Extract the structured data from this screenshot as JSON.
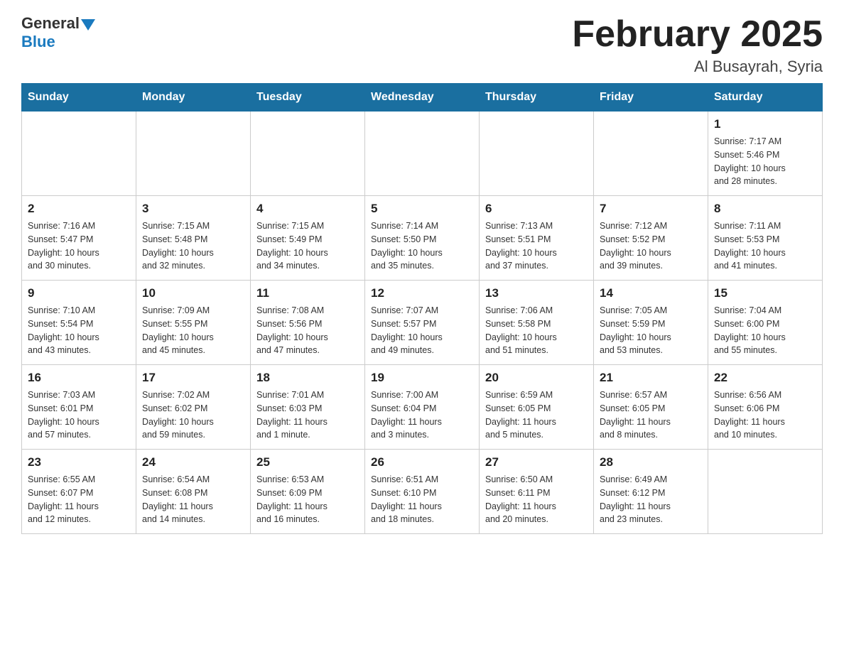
{
  "header": {
    "logo_general": "General",
    "logo_blue": "Blue",
    "month_title": "February 2025",
    "location": "Al Busayrah, Syria"
  },
  "days_of_week": [
    "Sunday",
    "Monday",
    "Tuesday",
    "Wednesday",
    "Thursday",
    "Friday",
    "Saturday"
  ],
  "weeks": [
    [
      {
        "day": "",
        "info": ""
      },
      {
        "day": "",
        "info": ""
      },
      {
        "day": "",
        "info": ""
      },
      {
        "day": "",
        "info": ""
      },
      {
        "day": "",
        "info": ""
      },
      {
        "day": "",
        "info": ""
      },
      {
        "day": "1",
        "info": "Sunrise: 7:17 AM\nSunset: 5:46 PM\nDaylight: 10 hours\nand 28 minutes."
      }
    ],
    [
      {
        "day": "2",
        "info": "Sunrise: 7:16 AM\nSunset: 5:47 PM\nDaylight: 10 hours\nand 30 minutes."
      },
      {
        "day": "3",
        "info": "Sunrise: 7:15 AM\nSunset: 5:48 PM\nDaylight: 10 hours\nand 32 minutes."
      },
      {
        "day": "4",
        "info": "Sunrise: 7:15 AM\nSunset: 5:49 PM\nDaylight: 10 hours\nand 34 minutes."
      },
      {
        "day": "5",
        "info": "Sunrise: 7:14 AM\nSunset: 5:50 PM\nDaylight: 10 hours\nand 35 minutes."
      },
      {
        "day": "6",
        "info": "Sunrise: 7:13 AM\nSunset: 5:51 PM\nDaylight: 10 hours\nand 37 minutes."
      },
      {
        "day": "7",
        "info": "Sunrise: 7:12 AM\nSunset: 5:52 PM\nDaylight: 10 hours\nand 39 minutes."
      },
      {
        "day": "8",
        "info": "Sunrise: 7:11 AM\nSunset: 5:53 PM\nDaylight: 10 hours\nand 41 minutes."
      }
    ],
    [
      {
        "day": "9",
        "info": "Sunrise: 7:10 AM\nSunset: 5:54 PM\nDaylight: 10 hours\nand 43 minutes."
      },
      {
        "day": "10",
        "info": "Sunrise: 7:09 AM\nSunset: 5:55 PM\nDaylight: 10 hours\nand 45 minutes."
      },
      {
        "day": "11",
        "info": "Sunrise: 7:08 AM\nSunset: 5:56 PM\nDaylight: 10 hours\nand 47 minutes."
      },
      {
        "day": "12",
        "info": "Sunrise: 7:07 AM\nSunset: 5:57 PM\nDaylight: 10 hours\nand 49 minutes."
      },
      {
        "day": "13",
        "info": "Sunrise: 7:06 AM\nSunset: 5:58 PM\nDaylight: 10 hours\nand 51 minutes."
      },
      {
        "day": "14",
        "info": "Sunrise: 7:05 AM\nSunset: 5:59 PM\nDaylight: 10 hours\nand 53 minutes."
      },
      {
        "day": "15",
        "info": "Sunrise: 7:04 AM\nSunset: 6:00 PM\nDaylight: 10 hours\nand 55 minutes."
      }
    ],
    [
      {
        "day": "16",
        "info": "Sunrise: 7:03 AM\nSunset: 6:01 PM\nDaylight: 10 hours\nand 57 minutes."
      },
      {
        "day": "17",
        "info": "Sunrise: 7:02 AM\nSunset: 6:02 PM\nDaylight: 10 hours\nand 59 minutes."
      },
      {
        "day": "18",
        "info": "Sunrise: 7:01 AM\nSunset: 6:03 PM\nDaylight: 11 hours\nand 1 minute."
      },
      {
        "day": "19",
        "info": "Sunrise: 7:00 AM\nSunset: 6:04 PM\nDaylight: 11 hours\nand 3 minutes."
      },
      {
        "day": "20",
        "info": "Sunrise: 6:59 AM\nSunset: 6:05 PM\nDaylight: 11 hours\nand 5 minutes."
      },
      {
        "day": "21",
        "info": "Sunrise: 6:57 AM\nSunset: 6:05 PM\nDaylight: 11 hours\nand 8 minutes."
      },
      {
        "day": "22",
        "info": "Sunrise: 6:56 AM\nSunset: 6:06 PM\nDaylight: 11 hours\nand 10 minutes."
      }
    ],
    [
      {
        "day": "23",
        "info": "Sunrise: 6:55 AM\nSunset: 6:07 PM\nDaylight: 11 hours\nand 12 minutes."
      },
      {
        "day": "24",
        "info": "Sunrise: 6:54 AM\nSunset: 6:08 PM\nDaylight: 11 hours\nand 14 minutes."
      },
      {
        "day": "25",
        "info": "Sunrise: 6:53 AM\nSunset: 6:09 PM\nDaylight: 11 hours\nand 16 minutes."
      },
      {
        "day": "26",
        "info": "Sunrise: 6:51 AM\nSunset: 6:10 PM\nDaylight: 11 hours\nand 18 minutes."
      },
      {
        "day": "27",
        "info": "Sunrise: 6:50 AM\nSunset: 6:11 PM\nDaylight: 11 hours\nand 20 minutes."
      },
      {
        "day": "28",
        "info": "Sunrise: 6:49 AM\nSunset: 6:12 PM\nDaylight: 11 hours\nand 23 minutes."
      },
      {
        "day": "",
        "info": ""
      }
    ]
  ]
}
